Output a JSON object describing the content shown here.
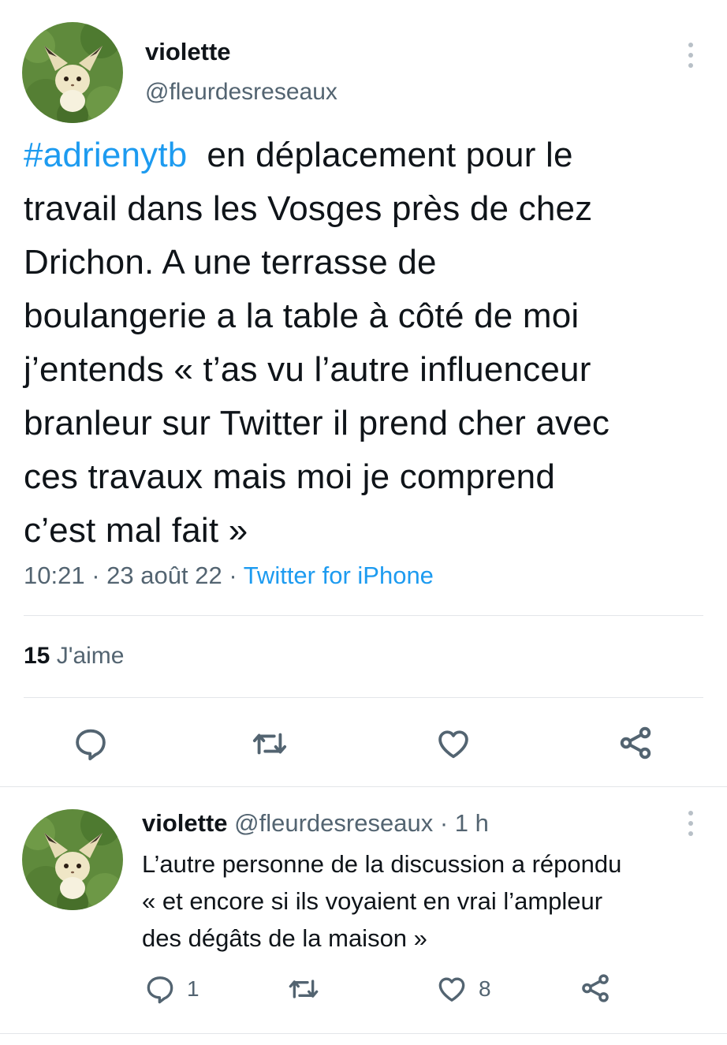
{
  "main_tweet": {
    "display_name": "violette",
    "handle": "@fleurdesreseaux",
    "hashtag": "#adrienytb",
    "text_lines": [
      "en déplacement pour le",
      "travail dans les Vosges près de chez",
      "Drichon.  A une terrasse de",
      "boulangerie a la table à côté de moi",
      "j’entends « t’as vu l’autre influenceur",
      "branleur sur Twitter il prend cher avec",
      "ces travaux mais moi je comprend",
      "c’est mal fait »"
    ],
    "time": "10:21",
    "date": "23 août 22",
    "separator": "·",
    "source": "Twitter for iPhone",
    "likes_count": "15",
    "likes_label": "J'aime"
  },
  "reply_tweet": {
    "display_name": "violette",
    "handle": "@fleurdesreseaux",
    "time_ago": "· 1 h",
    "text_lines": [
      "L’autre personne de la discussion a répondu",
      "« et encore si ils voyaient en vrai l’ampleur",
      "des dégâts de la maison »"
    ],
    "reply_count": "1",
    "like_count": "8"
  },
  "colors": {
    "accent": "#1d9bf0",
    "text_primary": "#0f1419",
    "text_secondary": "#536471",
    "icon": "#536471",
    "divider": "#e3e6e9"
  },
  "icons": [
    "more-options-icon",
    "reply-icon",
    "retweet-icon",
    "like-icon",
    "share-icon"
  ]
}
